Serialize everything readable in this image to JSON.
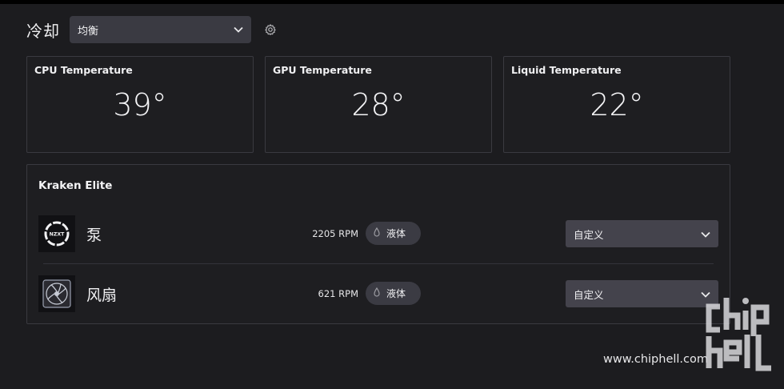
{
  "header": {
    "title": "冷却",
    "profile": "均衡"
  },
  "temperatures": [
    {
      "label": "CPU Temperature",
      "value": "39°"
    },
    {
      "label": "GPU Temperature",
      "value": "28°"
    },
    {
      "label": "Liquid Temperature",
      "value": "22°"
    }
  ],
  "device": {
    "name": "Kraken Elite",
    "rows": [
      {
        "name": "泵",
        "rpm": "2205 RPM",
        "source": "液体",
        "mode": "自定义",
        "icon": "nzxt-pump-icon",
        "icon_text": "NZXT"
      },
      {
        "name": "风扇",
        "rpm": "621 RPM",
        "source": "液体",
        "mode": "自定义",
        "icon": "fan-icon"
      }
    ]
  },
  "watermark": {
    "url": "www.chiphell.com"
  },
  "colors": {
    "background": "#1c1c1f",
    "card_border": "#3a3a40",
    "control": "#3a3a42",
    "pill": "#3b3b43"
  }
}
